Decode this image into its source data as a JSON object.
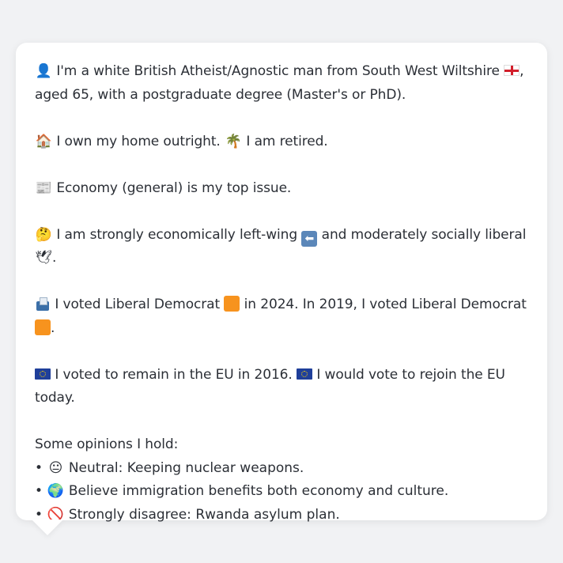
{
  "profile": {
    "line1": {
      "icon": "bust-in-silhouette-icon",
      "text_a": "I'm a white British Atheist/Agnostic man from South West Wiltshire",
      "flag": "england-flag-icon",
      "text_b": ",",
      "text_c": "aged 65, with a postgraduate degree (Master's or PhD)."
    },
    "line2": {
      "icon_home": "house-icon",
      "text_a": "I own my home outright.",
      "icon_retired": "palm-tree-icon",
      "text_b": "I am retired."
    },
    "line3": {
      "icon": "newspaper-icon",
      "text": "Economy (general) is my top issue."
    },
    "line4": {
      "icon_think": "thinking-face-icon",
      "text_a": "I am strongly economically left-wing",
      "icon_left": "left-arrow-icon",
      "text_b": "and moderately socially liberal",
      "icon_dove": "dove-icon",
      "text_c": "."
    },
    "line5": {
      "icon": "ballot-box-icon",
      "text_a": "I voted Liberal Democrat",
      "party_color": "#f7931e",
      "text_b": "in 2024. In 2019, I voted Liberal Democrat",
      "text_c": "."
    },
    "line6": {
      "icon": "eu-flag-icon",
      "text_a": "I voted to remain in the EU in 2016.",
      "text_b": "I would vote to rejoin the EU today."
    }
  },
  "opinions": {
    "heading": "Some opinions I hold:",
    "bullet": "•",
    "items": [
      {
        "icon": "neutral-face-icon",
        "glyph": "😐",
        "text": "Neutral: Keeping nuclear weapons."
      },
      {
        "icon": "globe-icon",
        "glyph": "🌍",
        "text": "Believe immigration benefits both economy and culture."
      },
      {
        "icon": "prohibited-icon",
        "glyph": "🚫",
        "text": "Strongly disagree: Rwanda asylum plan."
      }
    ]
  },
  "glyphs": {
    "bust": "👤",
    "house": "🏠",
    "palm": "🌴",
    "newspaper": "📰",
    "thinking": "🤔",
    "arrow": "⬅",
    "dove": "🕊"
  }
}
